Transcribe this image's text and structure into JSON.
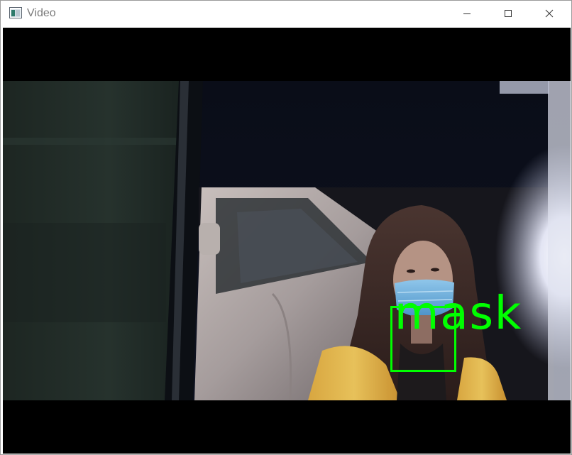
{
  "window": {
    "title": "Video",
    "icon": "app-window-icon",
    "controls": {
      "minimize_icon": "minimize-icon",
      "maximize_icon": "maximize-icon",
      "close_icon": "close-icon"
    }
  },
  "detection": {
    "label": "mask",
    "box_color": "#00ff00"
  },
  "colors": {
    "titlebar_bg": "#ffffff",
    "video_bg": "#000000",
    "detection": "#00ff00"
  }
}
